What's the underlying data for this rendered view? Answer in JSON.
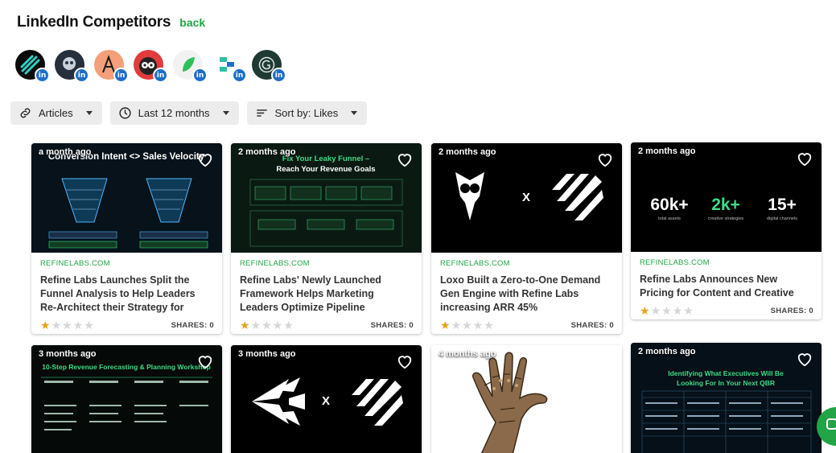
{
  "header": {
    "title": "LinkedIn Competitors",
    "back": "back"
  },
  "avatars": [
    {
      "name": "competitor-1",
      "li": "in"
    },
    {
      "name": "competitor-2",
      "li": "in"
    },
    {
      "name": "competitor-3",
      "li": "in"
    },
    {
      "name": "competitor-4",
      "li": "in"
    },
    {
      "name": "competitor-5",
      "li": "in"
    },
    {
      "name": "competitor-6",
      "li": "in"
    },
    {
      "name": "competitor-7",
      "li": "in"
    }
  ],
  "filters": {
    "type": "Articles",
    "period": "Last 12 months",
    "sort": "Sort by: Likes"
  },
  "cards": [
    {
      "date": "a month ago",
      "domain": "REFINELABS.COM",
      "title": "Refine Labs Launches Split the Funnel Analysis to Help Leaders Re-Architect their Strategy for Revenue",
      "shares": "SHARES: 0",
      "rating": 1,
      "thumb": {
        "heading": "Conversion Intent <> Sales Velocity"
      }
    },
    {
      "date": "2 months ago",
      "domain": "REFINELABS.COM",
      "title": "Refine Labs' Newly Launched Framework Helps Marketing Leaders Optimize Pipeline Performance In...",
      "shares": "SHARES: 0",
      "rating": 1,
      "thumb": {
        "heading": "Fix Your Leaky Funnel –",
        "sub": "Reach Your Revenue Goals"
      }
    },
    {
      "date": "2 months ago",
      "domain": "REFINELABS.COM",
      "title": "Loxo Built a Zero-to-One Demand Gen Engine with Refine Labs increasing ARR 45%",
      "shares": "SHARES: 0",
      "rating": 1,
      "thumb": {
        "x": "X"
      }
    },
    {
      "date": "2 months ago",
      "domain": "REFINELABS.COM",
      "title": "Refine Labs Announces New Pricing for Content and Creative Campaigns",
      "shares": "SHARES: 0",
      "rating": 1,
      "thumb": {
        "stats": [
          {
            "value": "60k+",
            "label": "total assets",
            "color": "#ffffff"
          },
          {
            "value": "2k+",
            "label": "creative strategies",
            "color": "#3ddc84"
          },
          {
            "value": "15+",
            "label": "digital channels",
            "color": "#ffffff"
          }
        ]
      }
    },
    {
      "date": "3 months ago",
      "thumb": {
        "heading": "10-Step Revenue Forecasting & Planning Workshop"
      }
    },
    {
      "date": "3 months ago",
      "thumb": {
        "x": "X"
      }
    },
    {
      "date": "4 months ago",
      "thumb": {}
    },
    {
      "date": "2 months ago",
      "thumb": {
        "heading": "Identifying What Executives Will Be",
        "sub": "Looking For In Your Next QBR"
      }
    }
  ],
  "colors": {
    "accent": "#22a447",
    "linkedin": "#1e6ec8",
    "star": "#e8a21a"
  }
}
